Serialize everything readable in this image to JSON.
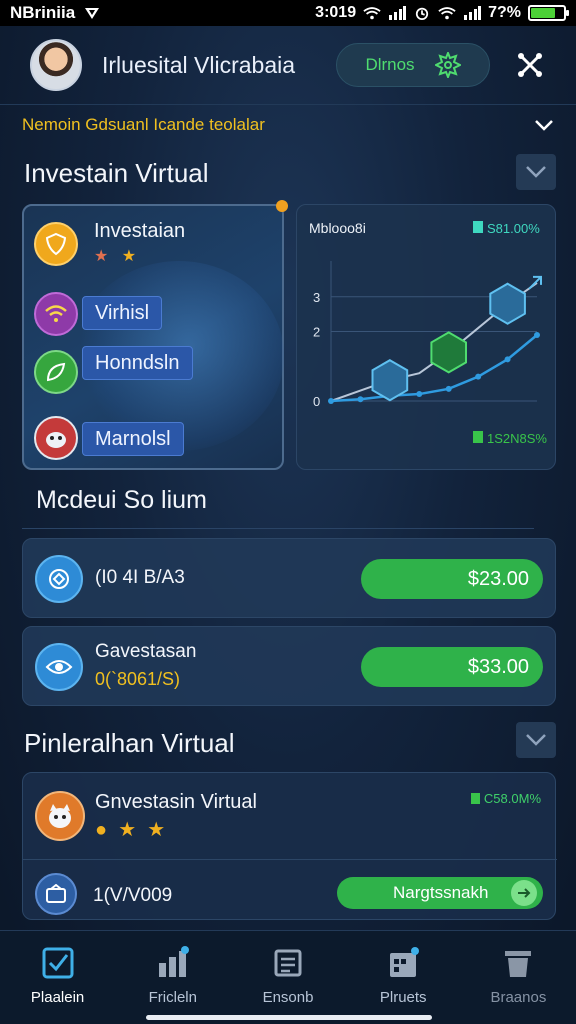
{
  "status_bar": {
    "carrier": "NBriniia",
    "time": "3:019",
    "battery": "7?%"
  },
  "header": {
    "title": "Irluesital Vlicrabaia",
    "pill_label": "Dlrnos"
  },
  "subheader": {
    "text": "Nemoin Gdsuanl Icande teolalar"
  },
  "section1": {
    "title": "Investain Virtual",
    "card_left": {
      "items": [
        {
          "label": "Investaian"
        },
        {
          "label": "Virhisl"
        },
        {
          "label": "Honndsln"
        },
        {
          "label": "Marnolsl"
        }
      ]
    },
    "card_right": {
      "title": "Mblooo8i",
      "top_value": "S81.00%",
      "bottom_value": "1S2N8S%",
      "y_ticks": [
        "3",
        "2",
        "0"
      ]
    }
  },
  "chart_data": {
    "type": "line",
    "title": "Mblooo8i",
    "x": [
      0,
      1,
      2,
      3,
      4,
      5,
      6,
      7
    ],
    "series": [
      {
        "values": [
          0,
          0.3,
          0.6,
          0.8,
          1.4,
          2.1,
          2.8,
          3.4
        ]
      },
      {
        "values": [
          0,
          0.05,
          0.15,
          0.2,
          0.35,
          0.7,
          1.2,
          1.9
        ]
      }
    ],
    "ylim": [
      0,
      3.8
    ],
    "y_ticks": [
      "3",
      "2",
      "0"
    ],
    "grid": true,
    "colors": [
      "#b8c6d8",
      "#2f9be0"
    ]
  },
  "section2": {
    "title": "Mcdeui So lium",
    "rows": [
      {
        "line1": "(I0 4I B/A3",
        "button": "$23.00"
      },
      {
        "line1": "Gavestasan",
        "line2": "0(`8061/S)",
        "button": "$33.00"
      }
    ]
  },
  "section3": {
    "title": "Pinleralhan Virtual",
    "card": {
      "title": "Gnvestasin Virtual",
      "percent": "C58.0M%",
      "row_text": "1(V/V009",
      "button": "Nargtssnakh"
    }
  },
  "nav": {
    "items": [
      {
        "label": "Plaalein"
      },
      {
        "label": "Fricleln"
      },
      {
        "label": "Ensonb"
      },
      {
        "label": "Plruets"
      },
      {
        "label": "Braanos"
      }
    ]
  },
  "colors": {
    "accent_green": "#2fb24a",
    "accent_blue": "#2f9be0",
    "warning": "#f0c020"
  }
}
